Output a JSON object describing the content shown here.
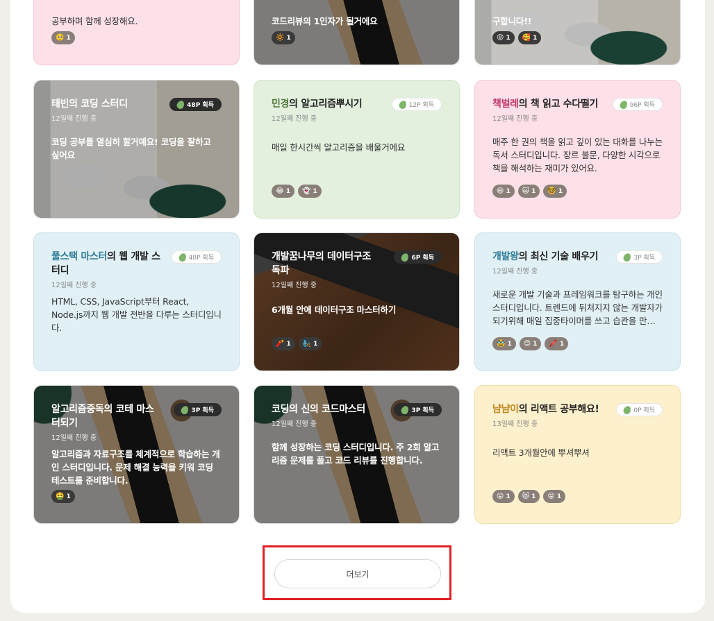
{
  "top_row": [
    {
      "desc_tail": "공부하며 함께 성장해요.",
      "reactions": [
        {
          "emoji": "🥺",
          "count": "1"
        }
      ]
    },
    {
      "desc_tail": "코드리뷰의 1인자가 될거에요",
      "reactions": [
        {
          "emoji": "🔆",
          "count": "1"
        }
      ]
    },
    {
      "desc_tail": "구합니다!!",
      "reactions": [
        {
          "emoji": "😝",
          "count": "1"
        },
        {
          "emoji": "🥰",
          "count": "1"
        }
      ]
    }
  ],
  "cards": [
    {
      "title_hl": "태빈",
      "title_rest": "의 코딩 스터디",
      "points": "48P 획득",
      "progress": "12일째 진행 중",
      "desc": "코딩 공부를 열심히 할거예요! 코딩을 잘하고 싶어요",
      "reactions": []
    },
    {
      "title_hl": "민경",
      "title_rest": "의 알고리즘뿌시기",
      "points": "12P 획득",
      "progress": "12일째 진행 중",
      "desc": "매일 한시간씩 알고리즘을 배울거에요",
      "reactions": [
        {
          "emoji": "😂",
          "count": "1"
        },
        {
          "emoji": "👻",
          "count": "1"
        }
      ]
    },
    {
      "title_hl": "책벌레",
      "title_rest": "의 책 읽고 수다떨기",
      "points": "96P 획득",
      "progress": "12일째 진행 중",
      "desc": "매주 한 권의 책을 읽고 깊이 있는 대화를 나누는 독서 스터디입니다. 장르 불문, 다양한 시각으로 책을 해석하는 재미가 있어요.",
      "reactions": [
        {
          "emoji": "😄",
          "count": "1"
        },
        {
          "emoji": "🙀",
          "count": "1"
        },
        {
          "emoji": "🤓",
          "count": "1"
        }
      ]
    },
    {
      "title_hl": "풀스택 마스터",
      "title_rest": "의 웹 개발 스터디",
      "points": "48P 획득",
      "progress": "12일째 진행 중",
      "desc": "HTML, CSS, JavaScript부터 React, Node.js까지 웹 개발 전반을 다루는 스터디입니다.",
      "reactions": []
    },
    {
      "title_hl": "",
      "title_rest": "개발꿈나무의 데이터구조 독파",
      "points": "6P 획득",
      "progress": "12일째 진행 중",
      "desc": "6개월 안에 데이터구조 마스터하기",
      "reactions": [
        {
          "emoji": "🧨",
          "count": "1"
        },
        {
          "emoji": "🧞",
          "count": "1"
        }
      ]
    },
    {
      "title_hl": "개발왕",
      "title_rest": "의 최신 기술 배우기",
      "points": "3P 획득",
      "progress": "12일째 진행 중",
      "desc": "새로운 개발 기술과 프레임워크를 탐구하는 개인 스터디입니다. 트렌드에 뒤처지지 않는 개발자가 되기위해 매일 집중타이머를 쓰고 습관을 만들어요.",
      "reactions": [
        {
          "emoji": "🥸",
          "count": "1"
        },
        {
          "emoji": "😊",
          "count": "1"
        },
        {
          "emoji": "🖍️",
          "count": "1"
        }
      ]
    },
    {
      "title_hl": "",
      "title_rest": "알고리즘중독의 코테 마스터되기",
      "points": "3P 획득",
      "progress": "12일째 진행 중",
      "desc": "알고리즘과 자료구조를 체계적으로 학습하는 개인 스터디입니다. 문제 해결 능력을 키워 코딩 테스트를 준비합니다.",
      "reactions": [
        {
          "emoji": "🤮",
          "count": "1"
        }
      ]
    },
    {
      "title_hl": "",
      "title_rest": "코딩의 신의 코드마스터",
      "points": "3P 획득",
      "progress": "12일째 진행 중",
      "desc": "함께 성장하는 코딩 스터디입니다. 주 2회 알고리즘 문제를 풀고 코드 리뷰를 진행합니다.",
      "reactions": []
    },
    {
      "title_hl": "냠냠이",
      "title_rest": "의 리액트 공부해요!",
      "points": "0P 획득",
      "progress": "13일째 진행 중",
      "desc": "리액트 3개월안에 뿌셔뿌셔",
      "reactions": [
        {
          "emoji": "😝",
          "count": "1"
        },
        {
          "emoji": "😻",
          "count": "1"
        },
        {
          "emoji": "😝",
          "count": "1"
        }
      ]
    }
  ],
  "more_button": {
    "label": "더보기"
  },
  "colors": {
    "pink_title": "#c2386a",
    "green_title": "#507a3a",
    "blue_title": "#2f7c99",
    "yellow_title": "#c0861a",
    "highlight_box": "#e01f26"
  }
}
